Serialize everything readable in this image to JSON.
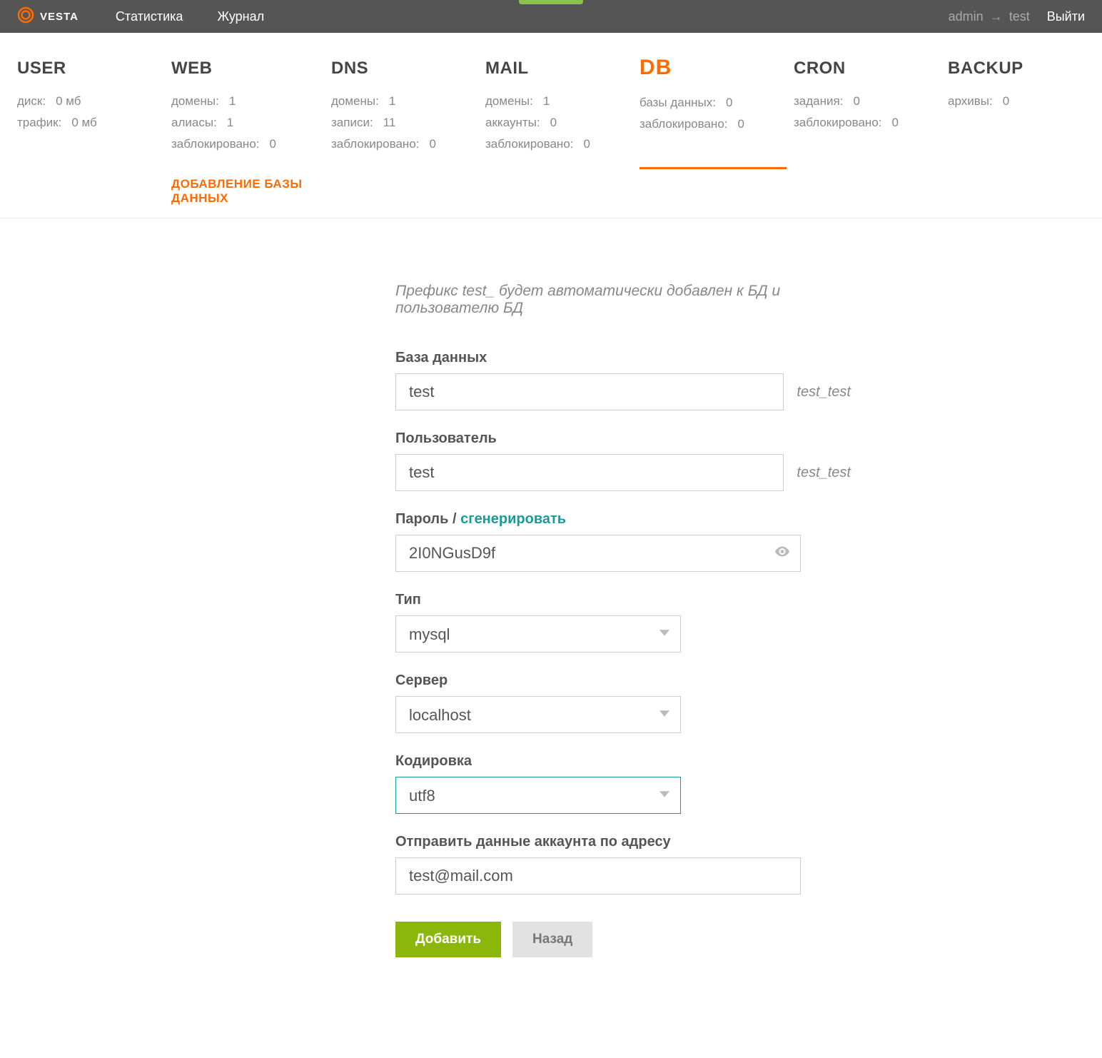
{
  "topbar": {
    "brand": "VESTA",
    "nav": {
      "stats": "Статистика",
      "journal": "Журнал"
    },
    "user_from": "admin",
    "user_to": "test",
    "logout": "Выйти"
  },
  "tabs": {
    "user": {
      "title": "USER",
      "rows": [
        {
          "k": "диск:",
          "v": "0 мб"
        },
        {
          "k": "трафик:",
          "v": "0 мб"
        }
      ]
    },
    "web": {
      "title": "WEB",
      "rows": [
        {
          "k": "домены:",
          "v": "1"
        },
        {
          "k": "алиасы:",
          "v": "1"
        },
        {
          "k": "заблокировано:",
          "v": "0"
        }
      ]
    },
    "dns": {
      "title": "DNS",
      "rows": [
        {
          "k": "домены:",
          "v": "1"
        },
        {
          "k": "записи:",
          "v": "11"
        },
        {
          "k": "заблокировано:",
          "v": "0"
        }
      ]
    },
    "mail": {
      "title": "MAIL",
      "rows": [
        {
          "k": "домены:",
          "v": "1"
        },
        {
          "k": "аккаунты:",
          "v": "0"
        },
        {
          "k": "заблокировано:",
          "v": "0"
        }
      ]
    },
    "db": {
      "title": "DB",
      "rows": [
        {
          "k": "базы данных:",
          "v": "0"
        },
        {
          "k": "заблокировано:",
          "v": "0"
        }
      ]
    },
    "cron": {
      "title": "CRON",
      "rows": [
        {
          "k": "задания:",
          "v": "0"
        },
        {
          "k": "заблокировано:",
          "v": "0"
        }
      ]
    },
    "backup": {
      "title": "BACKUP",
      "rows": [
        {
          "k": "архивы:",
          "v": "0"
        }
      ]
    }
  },
  "breadcrumb": "Добавление базы данных",
  "note": "Префикс test_ будет автоматически добавлен к БД и пользователю БД",
  "form": {
    "database_label": "База данных",
    "database_value": "test",
    "database_hint": "test_test",
    "user_label": "Пользователь",
    "user_value": "test",
    "user_hint": "test_test",
    "password_label_prefix": "Пароль /",
    "password_generate": "сгенерировать",
    "password_value": "2I0NGusD9f",
    "type_label": "Тип",
    "type_value": "mysql",
    "server_label": "Сервер",
    "server_value": "localhost",
    "charset_label": "Кодировка",
    "charset_value": "utf8",
    "email_label": "Отправить данные аккаунта по адресу",
    "email_value": "test@mail.com"
  },
  "actions": {
    "add": "Добавить",
    "back": "Назад"
  }
}
